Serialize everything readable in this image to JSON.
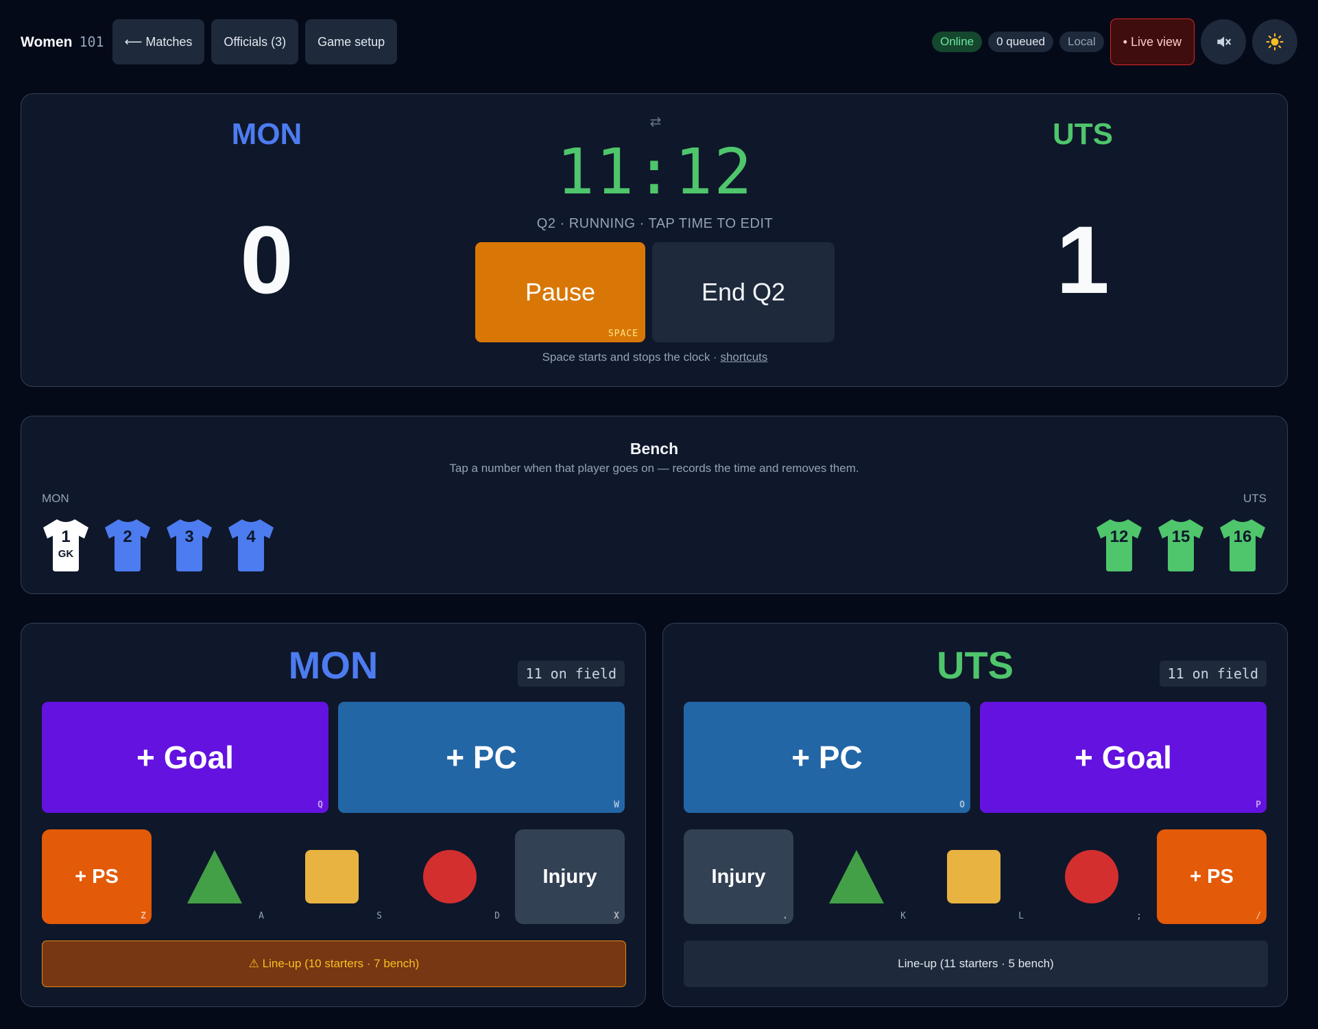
{
  "header": {
    "brand": "Women",
    "brand_code": "101",
    "matches_label": "⟵ Matches",
    "officials_label": "Officials (3)",
    "setup_label": "Game setup",
    "status_online": "Online",
    "status_queued": "0 queued",
    "status_local": "Local",
    "live_label": "• Live view",
    "sound_icon": "speaker-muted-icon",
    "theme_icon": "sun-icon"
  },
  "scoreboard": {
    "home_name": "MON",
    "away_name": "UTS",
    "home_score": "0",
    "away_score": "1",
    "swap_glyph": "⇄",
    "clock": "11:12",
    "status": "Q2 · RUNNING · TAP TIME TO EDIT",
    "pause_label": "Pause",
    "pause_key": "SPACE",
    "end_label": "End Q2",
    "hint_text": "Space starts and stops the clock · ",
    "hint_link": "shortcuts"
  },
  "bench": {
    "title": "Bench",
    "subtitle": "Tap a number when that player goes on — records the time and removes them.",
    "home_label": "MON",
    "away_label": "UTS",
    "home_players": [
      {
        "num": "1",
        "tag": "GK",
        "color": "#ffffff"
      },
      {
        "num": "2",
        "tag": "",
        "color": "#4d7cf0"
      },
      {
        "num": "3",
        "tag": "",
        "color": "#4d7cf0"
      },
      {
        "num": "4",
        "tag": "",
        "color": "#4d7cf0"
      }
    ],
    "away_players": [
      {
        "num": "12",
        "tag": "",
        "color": "#4fc56c"
      },
      {
        "num": "15",
        "tag": "",
        "color": "#4fc56c"
      },
      {
        "num": "16",
        "tag": "",
        "color": "#4fc56c"
      }
    ]
  },
  "home_panel": {
    "name": "MON",
    "on_field": "11 on field",
    "goal_label": "+ Goal",
    "goal_key": "Q",
    "pc_label": "+ PC",
    "pc_key": "W",
    "ps_label": "+ PS",
    "ps_key": "Z",
    "green_key": "A",
    "yellow_key": "S",
    "red_key": "D",
    "injury_label": "Injury",
    "injury_key": "X",
    "lineup": "⚠ Line-up (10 starters · 7 bench)"
  },
  "away_panel": {
    "name": "UTS",
    "on_field": "11 on field",
    "pc_label": "+ PC",
    "pc_key": "O",
    "goal_label": "+ Goal",
    "goal_key": "P",
    "injury_label": "Injury",
    "injury_key": ".",
    "green_key": "K",
    "yellow_key": "L",
    "red_key": ";",
    "ps_label": "+ PS",
    "ps_key": "/",
    "lineup": "Line-up (11 starters · 5 bench)"
  },
  "colors": {
    "home": "#4d7cf0",
    "away": "#4fc56c",
    "goal": "#6412e0",
    "pc": "#2266a6",
    "ps": "#e35a08",
    "pause": "#d97706"
  }
}
